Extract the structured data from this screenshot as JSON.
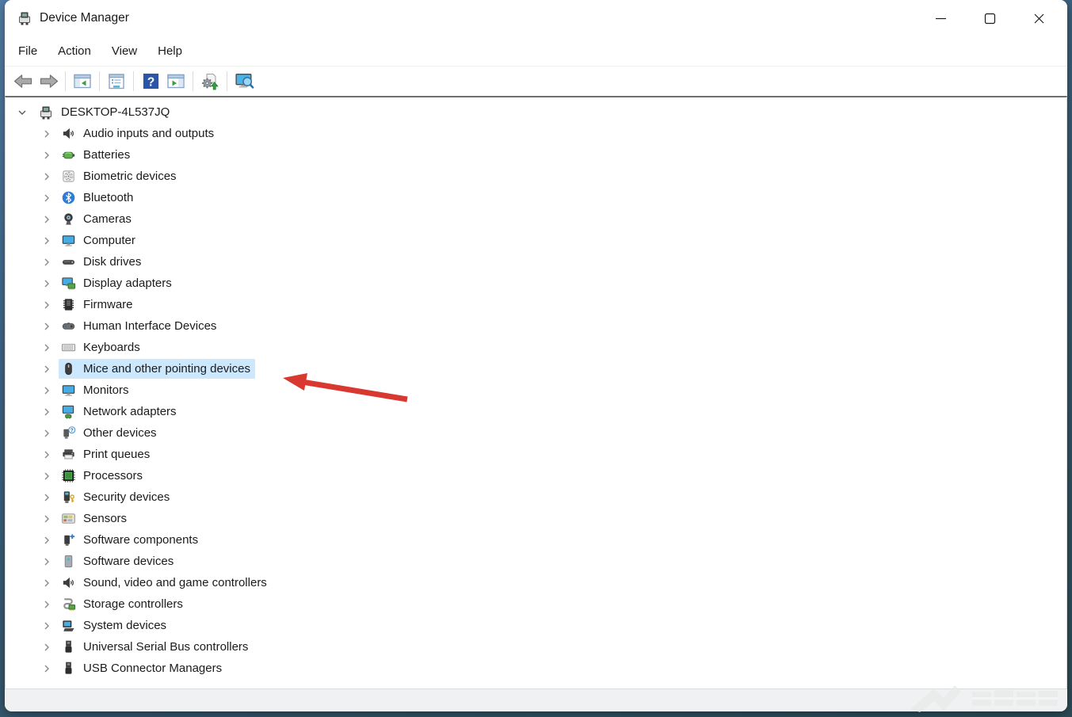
{
  "window": {
    "title": "Device Manager",
    "icon": "device-manager",
    "controls": [
      {
        "name": "minimize",
        "icon": "minimize"
      },
      {
        "name": "maximize",
        "icon": "maximize"
      },
      {
        "name": "close",
        "icon": "close"
      }
    ]
  },
  "menu": {
    "items": [
      {
        "label": "File"
      },
      {
        "label": "Action"
      },
      {
        "label": "View"
      },
      {
        "label": "Help"
      }
    ]
  },
  "toolbar": {
    "buttons": [
      {
        "name": "back",
        "icon": "arrow-left",
        "separator_after": false
      },
      {
        "name": "forward",
        "icon": "arrow-right",
        "separator_after": true
      },
      {
        "name": "show-console-tree",
        "icon": "console-tree",
        "separator_after": true
      },
      {
        "name": "properties",
        "icon": "properties",
        "separator_after": true
      },
      {
        "name": "help",
        "icon": "help",
        "separator_after": false
      },
      {
        "name": "action-pane",
        "icon": "action-pane",
        "separator_after": true
      },
      {
        "name": "add-drivers",
        "icon": "add-drivers",
        "separator_after": true
      },
      {
        "name": "scan-hardware-changes",
        "icon": "scan-hardware",
        "separator_after": false
      }
    ]
  },
  "tree": {
    "root": {
      "label": "DESKTOP-4L537JQ",
      "icon": "device-manager",
      "expanded": true
    },
    "items": [
      {
        "label": "Audio inputs and outputs",
        "icon": "speaker",
        "selected": false
      },
      {
        "label": "Batteries",
        "icon": "battery",
        "selected": false
      },
      {
        "label": "Biometric devices",
        "icon": "fingerprint",
        "selected": false
      },
      {
        "label": "Bluetooth",
        "icon": "bluetooth",
        "selected": false
      },
      {
        "label": "Cameras",
        "icon": "camera",
        "selected": false
      },
      {
        "label": "Computer",
        "icon": "monitor",
        "selected": false
      },
      {
        "label": "Disk drives",
        "icon": "disk-drive",
        "selected": false
      },
      {
        "label": "Display adapters",
        "icon": "display-adapter",
        "selected": false
      },
      {
        "label": "Firmware",
        "icon": "firmware",
        "selected": false
      },
      {
        "label": "Human Interface Devices",
        "icon": "hid",
        "selected": false
      },
      {
        "label": "Keyboards",
        "icon": "keyboard",
        "selected": false
      },
      {
        "label": "Mice and other pointing devices",
        "icon": "mouse",
        "selected": true
      },
      {
        "label": "Monitors",
        "icon": "monitor",
        "selected": false
      },
      {
        "label": "Network adapters",
        "icon": "network-adapter",
        "selected": false
      },
      {
        "label": "Other devices",
        "icon": "unknown-device",
        "selected": false
      },
      {
        "label": "Print queues",
        "icon": "printer",
        "selected": false
      },
      {
        "label": "Processors",
        "icon": "processor",
        "selected": false
      },
      {
        "label": "Security devices",
        "icon": "security-device",
        "selected": false
      },
      {
        "label": "Sensors",
        "icon": "sensor",
        "selected": false
      },
      {
        "label": "Software components",
        "icon": "software-component",
        "selected": false
      },
      {
        "label": "Software devices",
        "icon": "software-device",
        "selected": false
      },
      {
        "label": "Sound, video and game controllers",
        "icon": "speaker",
        "selected": false
      },
      {
        "label": "Storage controllers",
        "icon": "storage-controller",
        "selected": false
      },
      {
        "label": "System devices",
        "icon": "system-device",
        "selected": false
      },
      {
        "label": "Universal Serial Bus controllers",
        "icon": "usb",
        "selected": false
      },
      {
        "label": "USB Connector Managers",
        "icon": "usb",
        "selected": false
      }
    ]
  },
  "annotation": {
    "type": "arrow",
    "color": "#d93831",
    "points_to": "Mice and other pointing devices"
  },
  "colors": {
    "selection_highlight": "#cce8ff",
    "arrow_red": "#d93831",
    "status_bar": "#eff1f2",
    "content_border": "#6f6f6f"
  }
}
